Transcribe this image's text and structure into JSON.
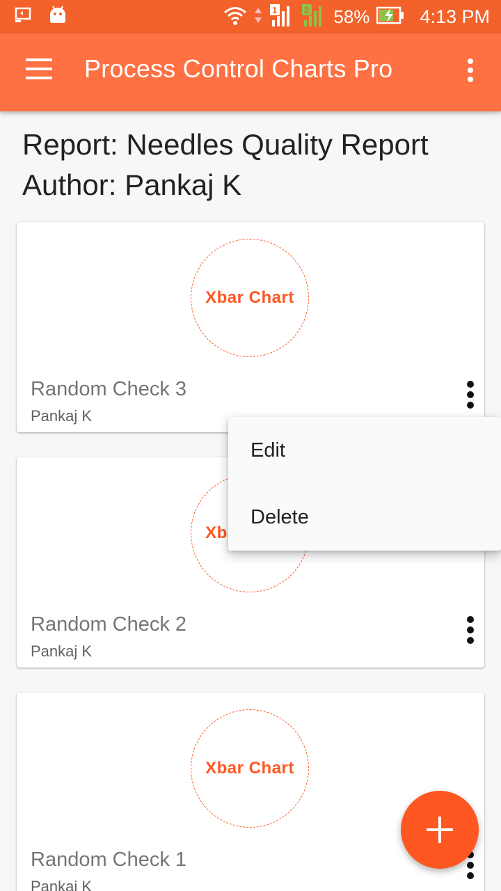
{
  "status_bar": {
    "battery_percent": "58%",
    "time": "4:13 PM",
    "sim1_label": "1",
    "sim2_label": "2",
    "icons": [
      "screen-cast-icon",
      "android-icon",
      "wifi-icon",
      "signal-sim1-icon",
      "signal-sim2-icon",
      "battery-charging-icon"
    ]
  },
  "app_bar": {
    "title": "Process Control Charts Pro",
    "menu_icon": "hamburger-menu-icon",
    "overflow_icon": "more-vert-icon"
  },
  "report": {
    "report_line": "Report: Needles Quality Report",
    "author_line": "Author: Pankaj K"
  },
  "cards": [
    {
      "badge": "Xbar Chart",
      "title": "Random Check 3",
      "author": "Pankaj K"
    },
    {
      "badge": "Xbar Chart",
      "title": "Random Check 2",
      "author": "Pankaj K"
    },
    {
      "badge": "Xbar Chart",
      "title": "Random Check 1",
      "author": "Pankaj K"
    }
  ],
  "popup_menu": {
    "items": [
      "Edit",
      "Delete"
    ]
  },
  "fab": {
    "icon": "add-icon"
  },
  "colors": {
    "status_bar": "#f2622a",
    "app_bar": "#ff7043",
    "accent": "#ff5722"
  }
}
